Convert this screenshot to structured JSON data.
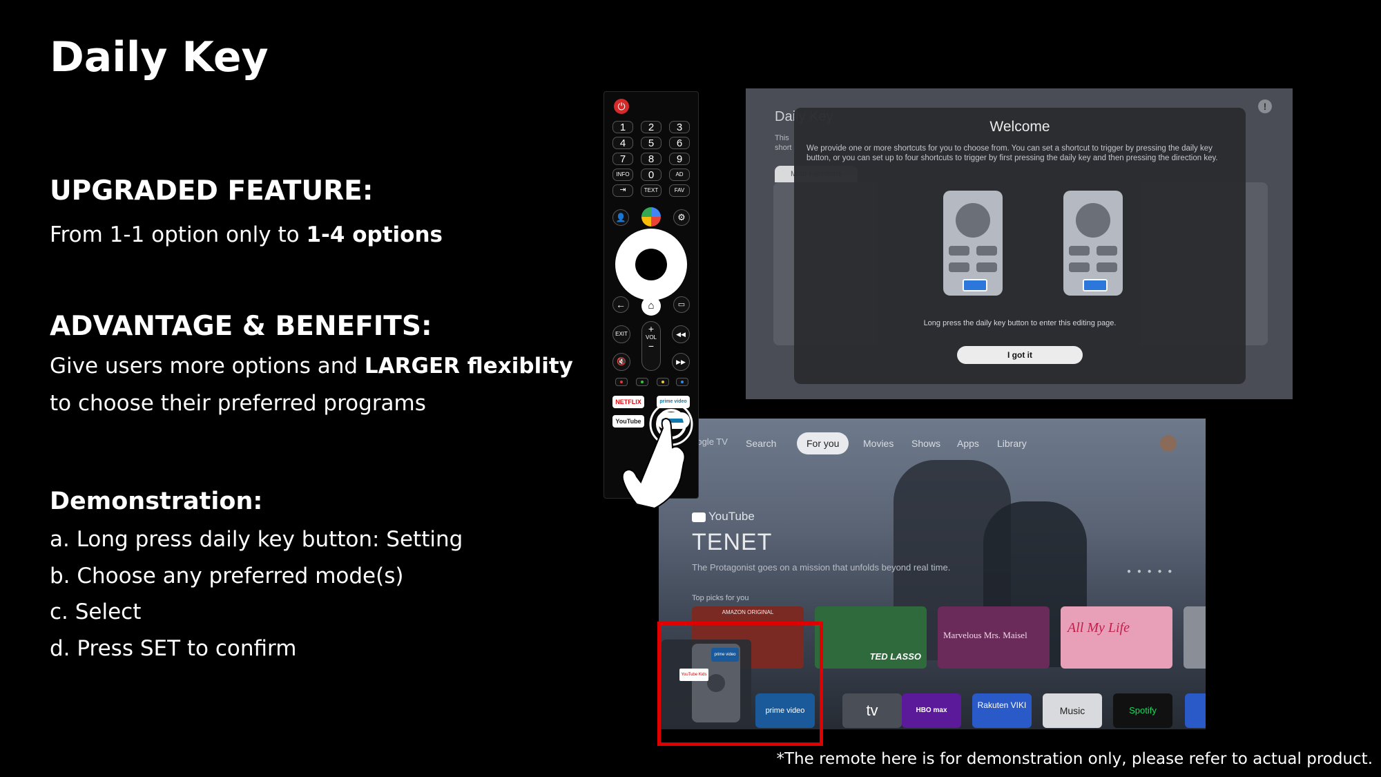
{
  "title": "Daily Key",
  "upgraded": {
    "heading": "UPGRADED FEATURE:",
    "text_prefix": "From 1-1 option only to ",
    "text_bold": "1-4 options"
  },
  "advantage": {
    "heading": "ADVANTAGE & BENEFITS:",
    "line1_prefix": "Give users more options and ",
    "line1_bold": "LARGER flexiblity",
    "line2": "to choose their preferred programs"
  },
  "demo": {
    "heading": "Demonstration:",
    "steps": [
      "a. Long press daily key button: Setting",
      "b. Choose any preferred mode(s)",
      "c. Select",
      "d. Press SET to confirm"
    ]
  },
  "footnote": "*The remote here is for demonstration only, please refer to actual product.",
  "remote": {
    "keys": [
      "1",
      "2",
      "3",
      "4",
      "5",
      "6",
      "7",
      "8",
      "9",
      "INFO",
      "0",
      "AD",
      "TEXT",
      "FAV"
    ],
    "exit": "EXIT",
    "vol_plus": "+",
    "vol": "VOL",
    "vol_minus": "−",
    "netflix": "NETFLIX",
    "prime": "prime video",
    "youtube": "YouTube"
  },
  "settings_screen": {
    "page_title": "Daily Key",
    "page_desc": "This",
    "page_desc2": "short",
    "tab": "Multi Functions",
    "dialog_title": "Welcome",
    "dialog_text": "We provide one or more shortcuts for you to choose from. You can set a shortcut to trigger by pressing the daily key button, or you can set up to four shortcuts to trigger by first pressing the daily key and then pressing the direction key.",
    "hint": "Long press the daily key button to enter this editing page.",
    "button": "I got it"
  },
  "gtv_screen": {
    "brand": "Google TV",
    "nav": [
      "Search",
      "For you",
      "Movies",
      "Shows",
      "Apps",
      "Library"
    ],
    "active_nav": "For you",
    "source": "YouTube",
    "movie_title": "TENET",
    "movie_desc": "The Protagonist goes on a mission that unfolds beyond real time.",
    "row_label": "Top picks for you",
    "picks": [
      "AMAZON ORIGINAL",
      "TED LASSO",
      "Marvelous Mrs. Maisel",
      "All My Life"
    ],
    "apps": [
      "prime video",
      "tv",
      "HBO max",
      "Rakuten VIKI",
      "Music",
      "Spotify"
    ],
    "overlay_prime": "prime video",
    "overlay_youtube": "YouTube Kids"
  }
}
